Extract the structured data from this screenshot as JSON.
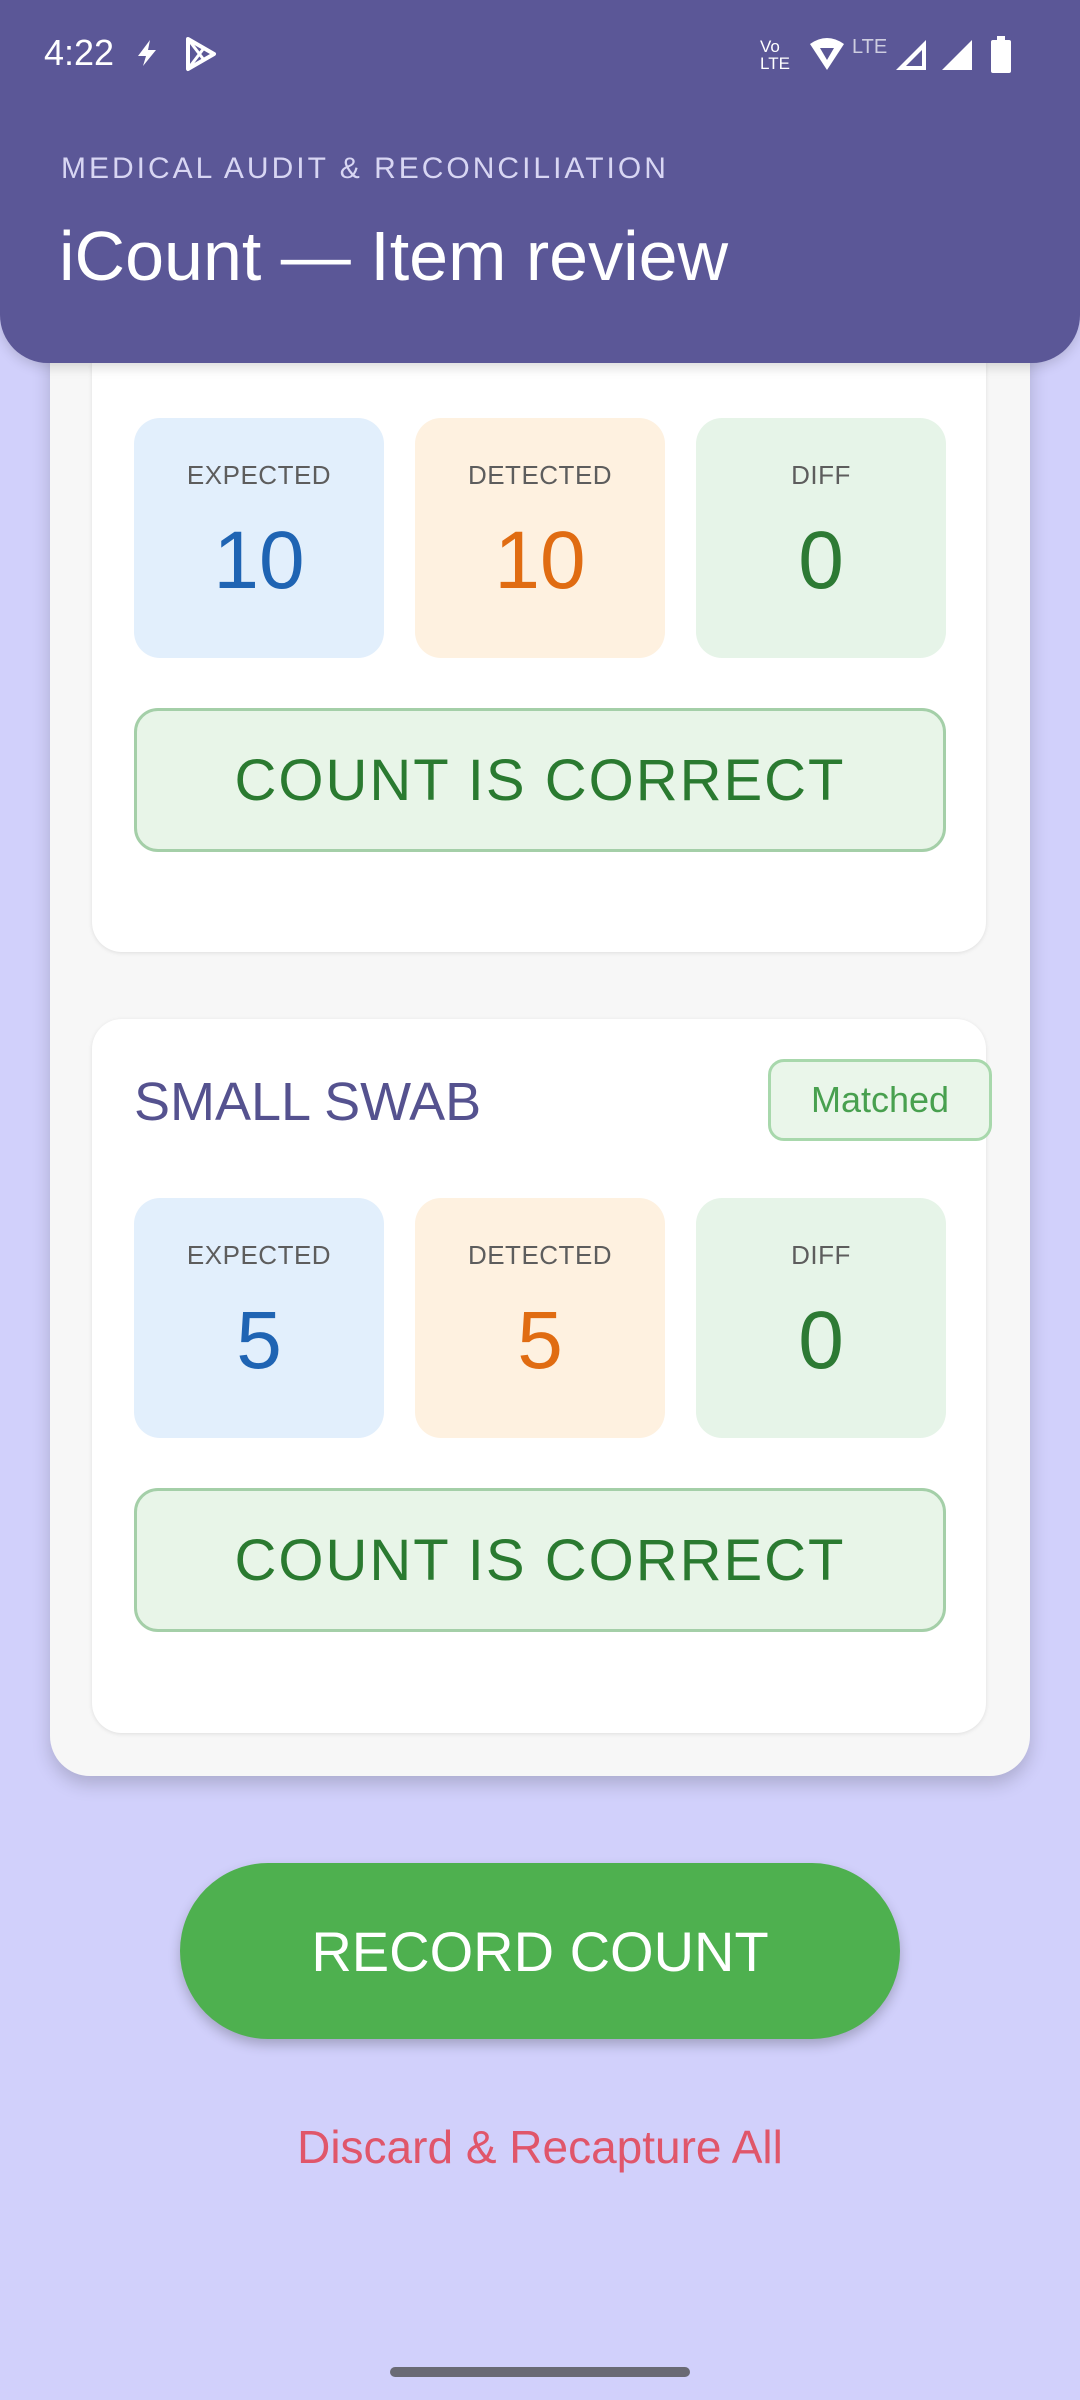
{
  "status_bar": {
    "time": "4:22",
    "icons": [
      "flash-icon",
      "play-store-icon",
      "volte-icon",
      "hotspot-icon",
      "lte-icon",
      "signal-icon",
      "signal-icon",
      "battery-icon"
    ],
    "volte_label": "Vo LTE",
    "lte_label": "LTE"
  },
  "header": {
    "eyebrow": "MEDICAL AUDIT & RECONCILIATION",
    "title": "iCount — Item review"
  },
  "stat_labels": {
    "expected": "EXPECTED",
    "detected": "DETECTED",
    "diff": "DIFF"
  },
  "items": [
    {
      "name": "",
      "expected": "10",
      "detected": "10",
      "diff": "0",
      "result_label": "COUNT IS CORRECT"
    },
    {
      "name": "SMALL SWAB",
      "status": "Matched",
      "expected": "5",
      "detected": "5",
      "diff": "0",
      "result_label": "COUNT IS CORRECT"
    }
  ],
  "actions": {
    "record_label": "RECORD COUNT",
    "discard_label": "Discard & Recapture All"
  },
  "colors": {
    "header_bg": "#5b5797",
    "page_bg": "#d1d0fb",
    "primary_green": "#4eb04f",
    "discard_red": "#e0566a"
  }
}
